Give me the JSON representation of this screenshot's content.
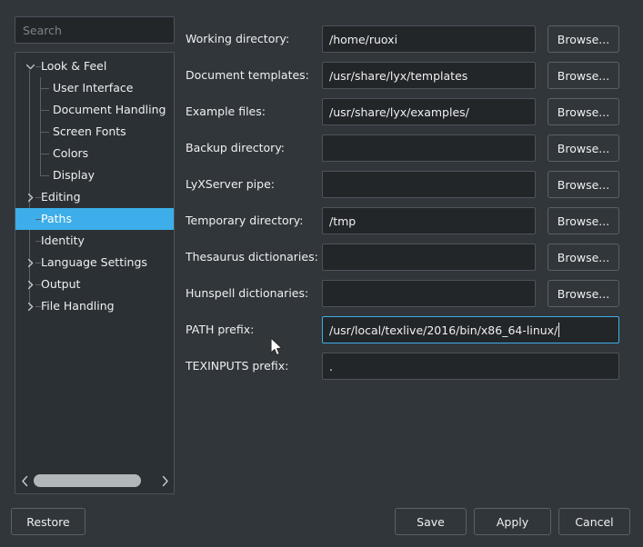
{
  "colors": {
    "window_bg": "#31363b",
    "panel_bg": "#2b3035",
    "field_bg": "#232629",
    "border": "#4c535a",
    "text": "#eff0f1",
    "placeholder": "#7b8287",
    "highlight": "#3daee9",
    "scrollbar_thumb": "#b2b7ba"
  },
  "search": {
    "placeholder": "Search",
    "value": ""
  },
  "tree": {
    "items": [
      {
        "label": "Look & Feel",
        "depth": 0,
        "twisty": "chevron-down-icon",
        "selected": false
      },
      {
        "label": "User Interface",
        "depth": 1,
        "twisty": "none",
        "selected": false
      },
      {
        "label": "Document Handling",
        "depth": 1,
        "twisty": "none",
        "selected": false
      },
      {
        "label": "Screen Fonts",
        "depth": 1,
        "twisty": "none",
        "selected": false
      },
      {
        "label": "Colors",
        "depth": 1,
        "twisty": "none",
        "selected": false
      },
      {
        "label": "Display",
        "depth": 1,
        "twisty": "none",
        "selected": false
      },
      {
        "label": "Editing",
        "depth": 0,
        "twisty": "chevron-right-icon",
        "selected": false
      },
      {
        "label": "Paths",
        "depth": 0,
        "twisty": "none",
        "selected": true
      },
      {
        "label": "Identity",
        "depth": 0,
        "twisty": "none",
        "selected": false
      },
      {
        "label": "Language Settings",
        "depth": 0,
        "twisty": "chevron-right-icon",
        "selected": false
      },
      {
        "label": "Output",
        "depth": 0,
        "twisty": "chevron-right-icon",
        "selected": false
      },
      {
        "label": "File Handling",
        "depth": 0,
        "twisty": "chevron-right-icon",
        "selected": false
      }
    ],
    "scrollbar": {
      "left_arrow": "chevron-left-icon",
      "right_arrow": "chevron-right-icon"
    }
  },
  "form": {
    "browse_label": "Browse...",
    "rows": [
      {
        "label": "Working directory:",
        "value": "/home/ruoxi",
        "browse": true,
        "wide": false,
        "focused": false
      },
      {
        "label": "Document templates:",
        "value": "/usr/share/lyx/templates",
        "browse": true,
        "wide": false,
        "focused": false
      },
      {
        "label": "Example files:",
        "value": "/usr/share/lyx/examples/",
        "browse": true,
        "wide": false,
        "focused": false
      },
      {
        "label": "Backup directory:",
        "value": "",
        "browse": true,
        "wide": false,
        "focused": false
      },
      {
        "label": "LyXServer pipe:",
        "value": "",
        "browse": true,
        "wide": false,
        "focused": false
      },
      {
        "label": "Temporary directory:",
        "value": "/tmp",
        "browse": true,
        "wide": false,
        "focused": false
      },
      {
        "label": "Thesaurus dictionaries:",
        "value": "",
        "browse": true,
        "wide": false,
        "focused": false
      },
      {
        "label": "Hunspell dictionaries:",
        "value": "",
        "browse": true,
        "wide": false,
        "focused": false
      },
      {
        "label": "PATH prefix:",
        "value": "/usr/local/texlive/2016/bin/x86_64-linux/",
        "browse": false,
        "wide": true,
        "focused": true
      },
      {
        "label": "TEXINPUTS prefix:",
        "value": ".",
        "browse": false,
        "wide": true,
        "focused": false
      }
    ]
  },
  "buttons": {
    "restore": "Restore",
    "save": "Save",
    "apply": "Apply",
    "cancel": "Cancel"
  }
}
